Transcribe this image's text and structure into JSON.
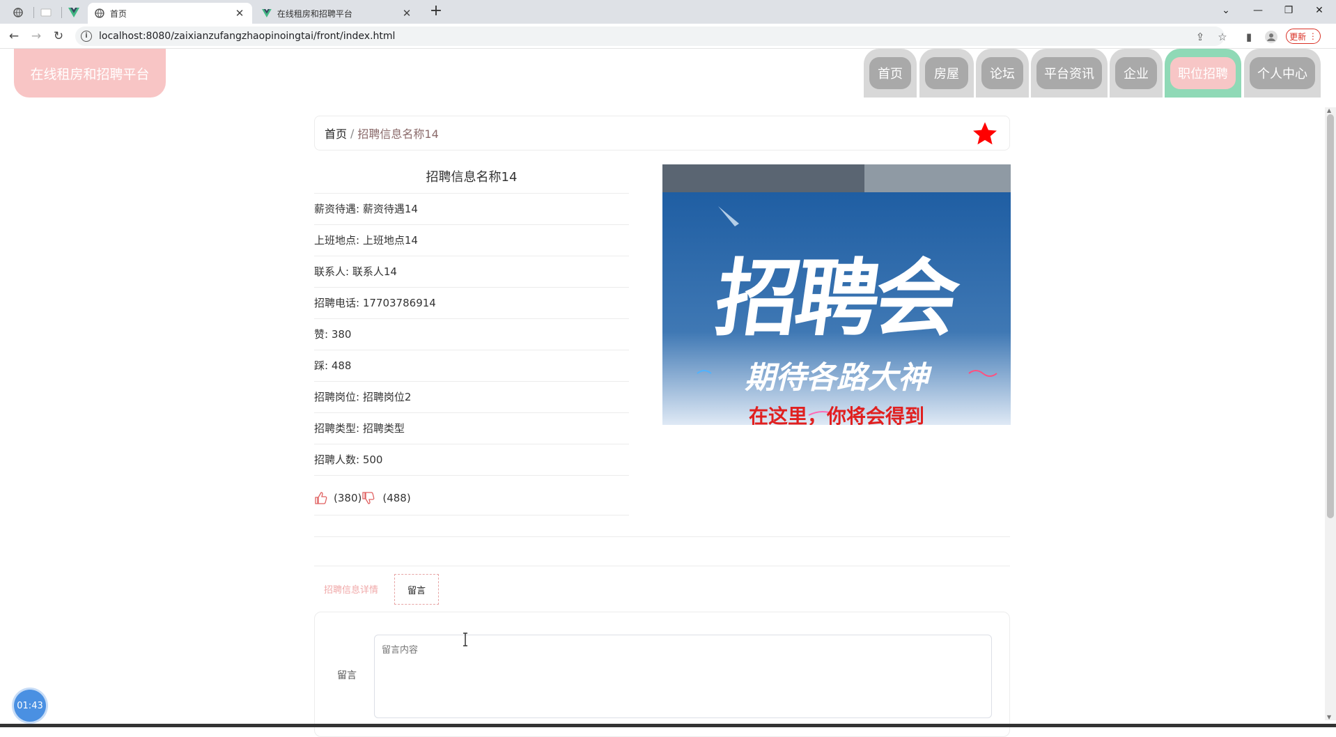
{
  "browser": {
    "tabs": [
      {
        "title": "首页",
        "active": true
      },
      {
        "title": "在线租房和招聘平台",
        "active": false
      }
    ],
    "new_tab": "+",
    "url": "localhost:8080/zaixianzufangzhaopinoingtai/front/index.html",
    "update_label": "更新"
  },
  "site": {
    "brand": "在线租房和招聘平台",
    "nav": [
      {
        "label": "首页",
        "active": false
      },
      {
        "label": "房屋",
        "active": false
      },
      {
        "label": "论坛",
        "active": false
      },
      {
        "label": "平台资讯",
        "active": false
      },
      {
        "label": "企业",
        "active": false
      },
      {
        "label": "职位招聘",
        "active": true
      },
      {
        "label": "个人中心",
        "active": false
      }
    ],
    "accent_color": "#f7c6c6",
    "active_border_color": "#8fd9b6"
  },
  "breadcrumb": {
    "home": "首页",
    "separator": "/",
    "current": "招聘信息名称14"
  },
  "detail": {
    "title": "招聘信息名称14",
    "fields": [
      {
        "label": "薪资待遇",
        "value": "薪资待遇14"
      },
      {
        "label": "上班地点",
        "value": "上班地点14"
      },
      {
        "label": "联系人",
        "value": "联系人14"
      },
      {
        "label": "招聘电话",
        "value": "17703786914"
      },
      {
        "label": "赞",
        "value": "380"
      },
      {
        "label": "踩",
        "value": "488"
      },
      {
        "label": "招聘岗位",
        "value": "招聘岗位2"
      },
      {
        "label": "招聘类型",
        "value": "招聘类型"
      },
      {
        "label": "招聘人数",
        "value": "500"
      }
    ],
    "likes": "(380)",
    "dislikes": "(488)"
  },
  "poster": {
    "headline": "招聘会",
    "subline": "期待各路大神",
    "bottom": "在这里，你将会得到"
  },
  "tabs": {
    "detail": "招聘信息详情",
    "message": "留言"
  },
  "form": {
    "label": "留言",
    "placeholder": "留言内容"
  },
  "timer": "01:43"
}
